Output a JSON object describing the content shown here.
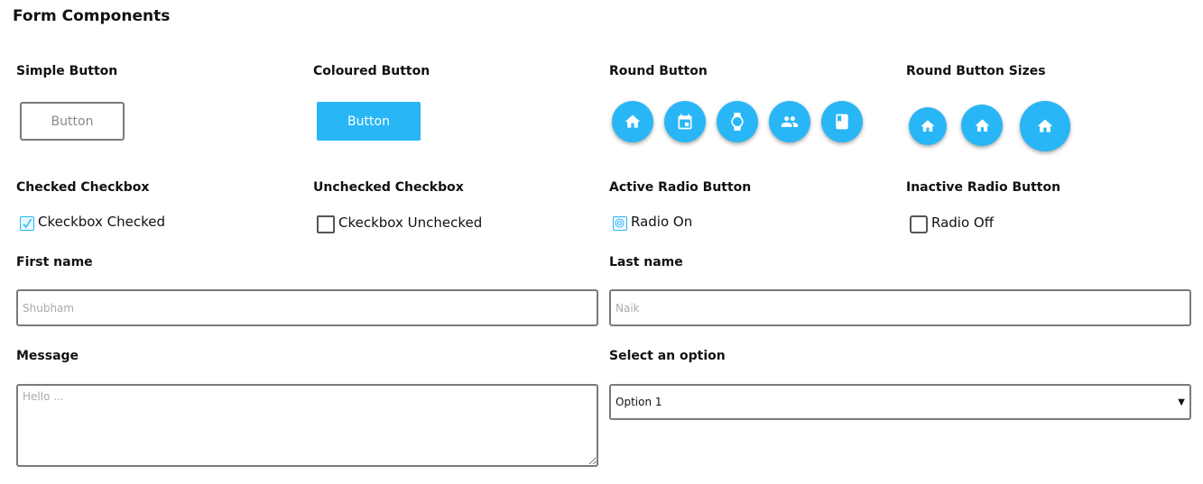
{
  "page": {
    "title": "Form Components"
  },
  "sections": {
    "simple_button": "Simple Button",
    "coloured_button": "Coloured Button",
    "round_button": "Round Button",
    "round_button_sizes": "Round Button Sizes",
    "checked_checkbox": "Checked Checkbox",
    "unchecked_checkbox": "Unchecked Checkbox",
    "active_radio": "Active Radio Button",
    "inactive_radio": "Inactive Radio Button"
  },
  "buttons": {
    "simple_label": "Button",
    "coloured_label": "Button"
  },
  "round_buttons": {
    "icons": [
      "home-icon",
      "calendar-icon",
      "watch-icon",
      "people-icon",
      "book-icon"
    ],
    "size_icons": [
      "home-icon",
      "home-icon",
      "home-icon"
    ]
  },
  "checkboxes": {
    "checked_label": "Ckeckbox Checked",
    "unchecked_label": "Ckeckbox Unchecked",
    "checked_state": true,
    "unchecked_state": false
  },
  "radios": {
    "on_label": "Radio On",
    "off_label": "Radio Off",
    "on_state": true,
    "off_state": false
  },
  "form": {
    "first_name_label": "First name",
    "first_name_placeholder": "Shubham",
    "last_name_label": "Last name",
    "last_name_placeholder": "Naik",
    "message_label": "Message",
    "message_placeholder": "Hello ...",
    "select_label": "Select an option",
    "select_value": "Option 1"
  },
  "colors": {
    "accent": "#29b6f6",
    "border": "#7a7a7a"
  }
}
